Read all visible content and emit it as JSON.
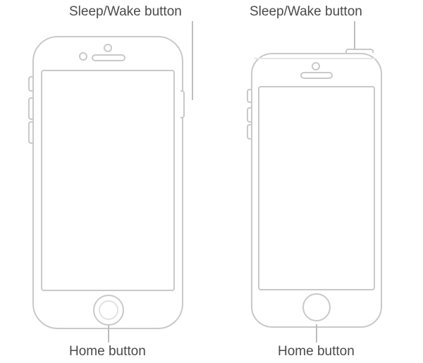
{
  "labels": {
    "sleep_wake_left": "Sleep/Wake button",
    "sleep_wake_right": "Sleep/Wake button",
    "home_left": "Home button",
    "home_right": "Home button"
  }
}
